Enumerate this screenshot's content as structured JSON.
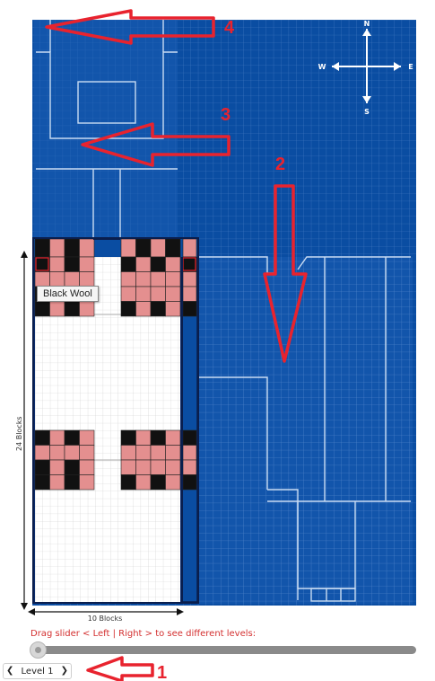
{
  "colors": {
    "blueprint": "#0a4da2",
    "grid_line": "#5f8fd1",
    "outline": "#c9dcf3",
    "annotation": "#e8232e",
    "pink": "#e48f8f",
    "black": "#111111",
    "white_area": "#ffffff"
  },
  "compass": {
    "north": "N",
    "south": "S",
    "east": "E",
    "west": "W"
  },
  "dimensions": {
    "height_label": "24 Blocks",
    "width_label": "10 Blocks"
  },
  "tooltip": "Black Wool",
  "instructions": "Drag slider < Left | Right > to see different levels:",
  "slider": {
    "value": 0
  },
  "level": {
    "label": "Level 1",
    "prev_icon": "chevron-left-icon",
    "next_icon": "chevron-right-icon"
  },
  "annotations": [
    "1",
    "2",
    "3",
    "4"
  ]
}
